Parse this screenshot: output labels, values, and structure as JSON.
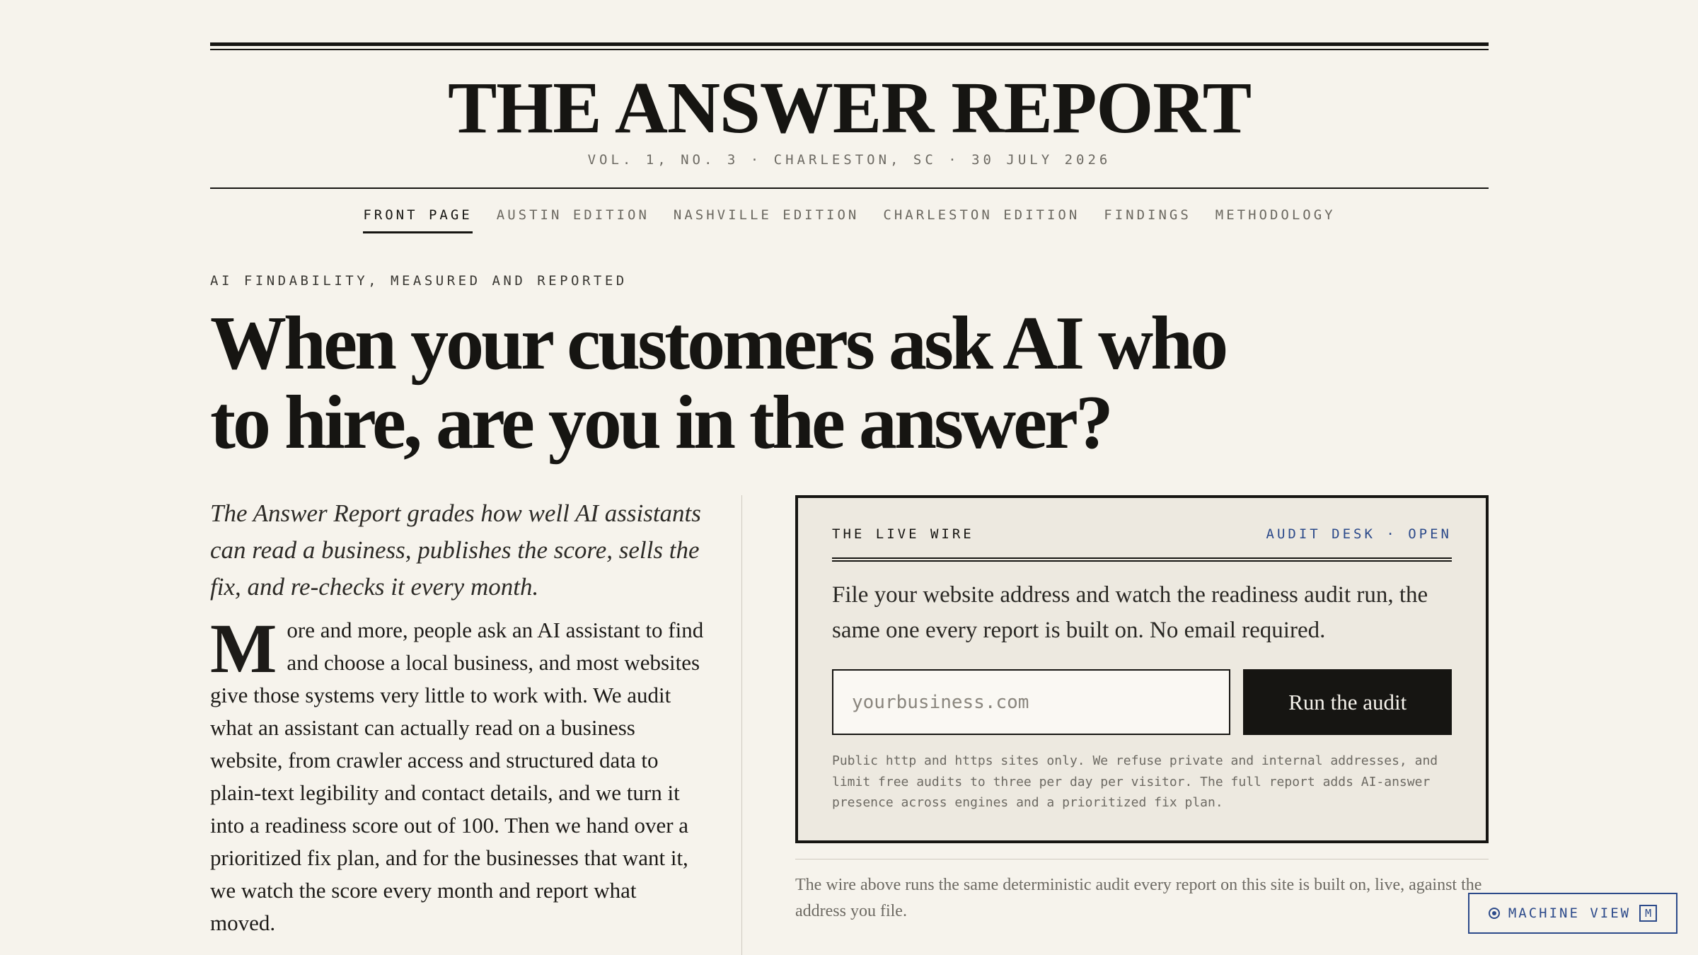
{
  "masthead": {
    "title": "THE ANSWER REPORT",
    "issue": "VOL. 1, NO. 3 · CHARLESTON, SC · 30 JULY 2026"
  },
  "nav": {
    "items": [
      {
        "label": "FRONT PAGE",
        "active": true
      },
      {
        "label": "AUSTIN EDITION"
      },
      {
        "label": "NASHVILLE EDITION"
      },
      {
        "label": "CHARLESTON EDITION"
      },
      {
        "label": "FINDINGS"
      },
      {
        "label": "METHODOLOGY"
      }
    ]
  },
  "hero": {
    "kicker": "AI FINDABILITY, MEASURED AND REPORTED",
    "headline": "When your customers ask AI who to hire, are you in the answer?"
  },
  "article": {
    "dek": "The Answer Report grades how well AI assistants can read a business, publishes the score, sells the fix, and re-checks it every month.",
    "dropcap": "M",
    "body": "ore and more, people ask an AI assistant to find and choose a local business, and most websites give those systems very little to work with. We audit what an assistant can actually read on a business website, from crawler access and structured data to plain-text legibility and contact details, and we turn it into a readiness score out of 100. Then we hand over a prioritized fix plan, and for the businesses that want it, we watch the score every month and report what moved."
  },
  "wire": {
    "label": "THE LIVE WIRE",
    "status": "AUDIT DESK · OPEN",
    "description": "File your website address and watch the readiness audit run, the same one every report is built on. No email required.",
    "input_value": "",
    "input_placeholder": "yourbusiness.com",
    "button_label": "Run the audit",
    "note": "Public http and https sites only. We refuse private and internal addresses, and limit free audits to three per day per visitor. The full report adds AI-answer presence across engines and a prioritized fix plan.",
    "caption": "The wire above runs the same deterministic audit every report on this site is built on, live, against the address you file."
  },
  "machine_view": {
    "label": "MACHINE VIEW",
    "shortcut": "M",
    "accent": "#2c4a8a"
  }
}
